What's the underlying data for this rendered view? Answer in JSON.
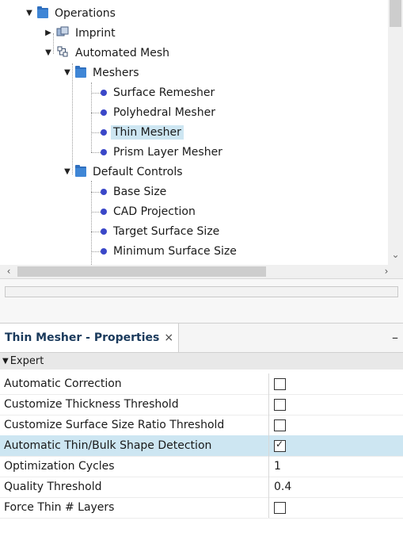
{
  "tree": {
    "items": [
      {
        "label": "Operations",
        "icon": "folder-icon",
        "expanded": true
      },
      {
        "label": "Imprint",
        "icon": "imprint-icon",
        "expanded": false
      },
      {
        "label": "Automated Mesh",
        "icon": "automated-mesh-icon",
        "expanded": true
      },
      {
        "label": "Meshers",
        "icon": "folder-icon",
        "expanded": true
      },
      {
        "label": "Surface Remesher",
        "icon": "mesher-dot-icon"
      },
      {
        "label": "Polyhedral Mesher",
        "icon": "mesher-dot-icon"
      },
      {
        "label": "Thin Mesher",
        "icon": "mesher-dot-icon",
        "selected": true
      },
      {
        "label": "Prism Layer Mesher",
        "icon": "mesher-dot-icon"
      },
      {
        "label": "Default Controls",
        "icon": "folder-icon",
        "expanded": true
      },
      {
        "label": "Base Size",
        "icon": "control-dot-icon"
      },
      {
        "label": "CAD Projection",
        "icon": "control-dot-icon"
      },
      {
        "label": "Target Surface Size",
        "icon": "control-dot-icon"
      },
      {
        "label": "Minimum Surface Size",
        "icon": "control-dot-icon"
      }
    ]
  },
  "properties": {
    "tab_label": "Thin Mesher - Properties",
    "close_glyph": "×",
    "minimize_glyph": "–",
    "section": "Expert",
    "rows": [
      {
        "name": "Automatic Correction",
        "type": "checkbox",
        "checked": false
      },
      {
        "name": "Customize Thickness Threshold",
        "type": "checkbox",
        "checked": false
      },
      {
        "name": "Customize Surface Size Ratio Threshold",
        "type": "checkbox",
        "checked": false
      },
      {
        "name": "Automatic Thin/Bulk Shape Detection",
        "type": "checkbox",
        "checked": true,
        "highlighted": true
      },
      {
        "name": "Optimization Cycles",
        "type": "text",
        "value": "1"
      },
      {
        "name": "Quality Threshold",
        "type": "text",
        "value": "0.4"
      },
      {
        "name": "Force Thin # Layers",
        "type": "checkbox",
        "checked": false
      }
    ]
  },
  "colors": {
    "selection": "#cde6f2",
    "folder": "#3f86d6",
    "dot": "#3a47c8"
  }
}
